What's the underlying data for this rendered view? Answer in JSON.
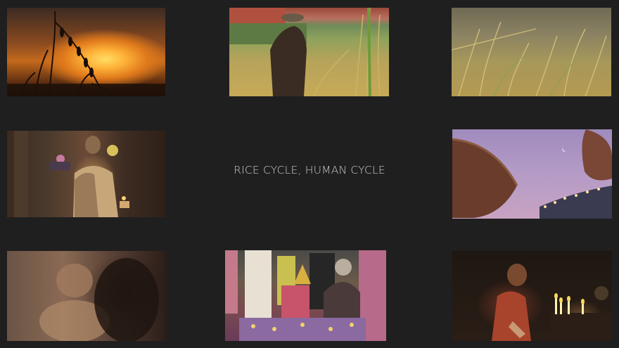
{
  "page": {
    "title": "RICE CYCLE, HUMAN CYCLE",
    "background": "#1f1f1f"
  },
  "tiles": [
    {
      "subject": "rice stalks at sunset"
    },
    {
      "subject": "farmer in rice field"
    },
    {
      "subject": "rice field close-up"
    },
    {
      "subject": "monk at shrine"
    },
    {
      "subject": "umbrellas at dusk with crescent moon"
    },
    {
      "subject": "blurred face close-up"
    },
    {
      "subject": "ceremony crowd"
    },
    {
      "subject": "monk with candles"
    }
  ]
}
